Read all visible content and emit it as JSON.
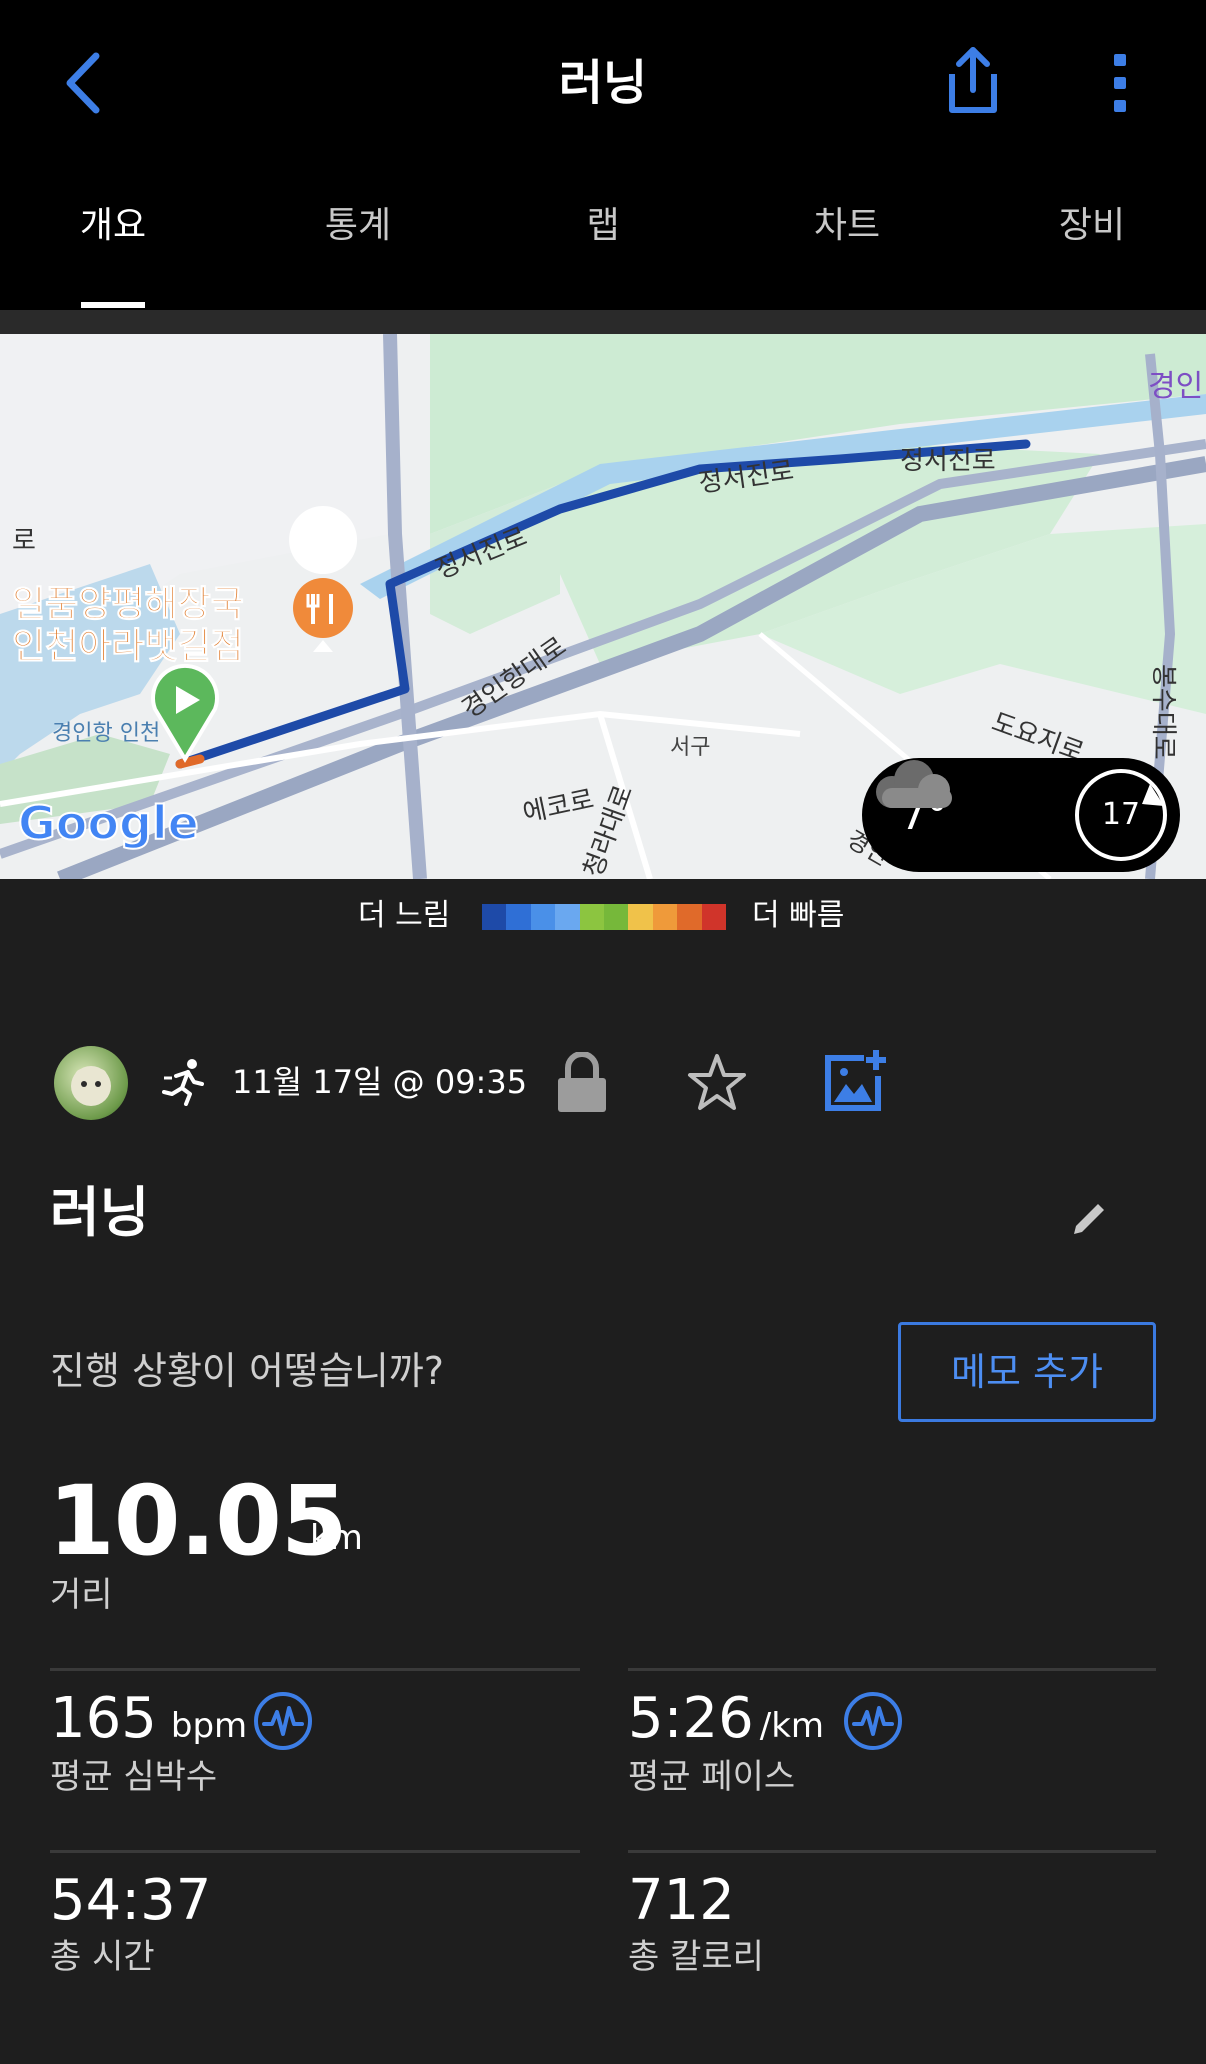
{
  "header": {
    "title": "러닝",
    "tabs": [
      {
        "label": "개요"
      },
      {
        "label": "통계"
      },
      {
        "label": "랩"
      },
      {
        "label": "차트"
      },
      {
        "label": "장비"
      }
    ]
  },
  "map": {
    "labels": {
      "road1": "정서진로",
      "road2": "정서진로",
      "road3": "정서진로",
      "road4": "경인항대로",
      "road5": "도요지로",
      "road6": "서구",
      "road7": "에코로",
      "road8": "청라대로",
      "road9": "경인",
      "poi_line1": "일품양평해장국",
      "poi_line2": "인천아라뱃길점",
      "harbor": "경인항 인천",
      "left_edge": "로",
      "right_edge": "경인",
      "vertical_road": "봉수대로",
      "provider": "Google"
    },
    "weather": {
      "temperature": "7°",
      "condition_icon": "cloud-icon",
      "wind": "17"
    }
  },
  "legend": {
    "slow": "더 느림",
    "fast": "더 빠름",
    "colors": [
      "#1e4aa8",
      "#2f6fd6",
      "#4a90e8",
      "#6aa8f0",
      "#8cc540",
      "#76b83a",
      "#f0c24a",
      "#ef9a3a",
      "#e06a2a",
      "#d0342a"
    ]
  },
  "activity": {
    "datetime": "11월 17일 @ 09:35",
    "name": "러닝",
    "question": "진행 상황이 어떻습니까?",
    "memo_button": "메모 추가"
  },
  "summary": {
    "distance": {
      "value": "10.05",
      "unit": "km",
      "label": "거리"
    },
    "stats": [
      {
        "value": "165",
        "unit": "bpm",
        "label": "평균 심박수"
      },
      {
        "value": "5:26",
        "unit": "/km",
        "label": "평균 페이스"
      },
      {
        "value": "54:37",
        "unit": "",
        "label": "총 시간"
      },
      {
        "value": "712",
        "unit": "",
        "label": "총 칼로리"
      }
    ]
  },
  "colors": {
    "accent": "#3b7ae0",
    "background": "#1e1e1e",
    "header": "#000000",
    "route": "#1e4aa8"
  }
}
